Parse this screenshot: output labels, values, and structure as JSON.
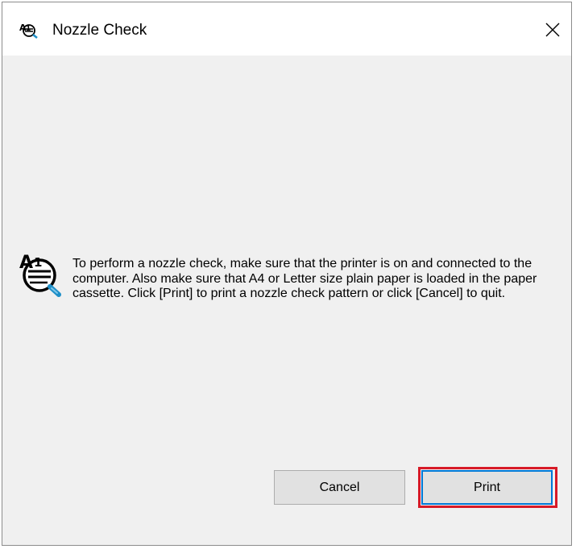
{
  "window": {
    "title": "Nozzle Check",
    "title_icon": "printer-nozzle-icon",
    "close_icon": "close-icon"
  },
  "dialog": {
    "icon": "nozzle-check-icon",
    "message": "To perform a nozzle check, make sure that the printer is on and connected to the computer. Also make sure that A4 or Letter size plain paper is loaded in the paper cassette. Click [Print] to print a nozzle check pattern or click [Cancel] to quit."
  },
  "buttons": {
    "cancel_label": "Cancel",
    "print_label": "Print"
  },
  "colors": {
    "dialog_background": "#f0f0f0",
    "button_face": "#e1e1e1",
    "button_border": "#adadad",
    "focus_border": "#0078d7",
    "annotation_highlight": "#d71a27"
  }
}
